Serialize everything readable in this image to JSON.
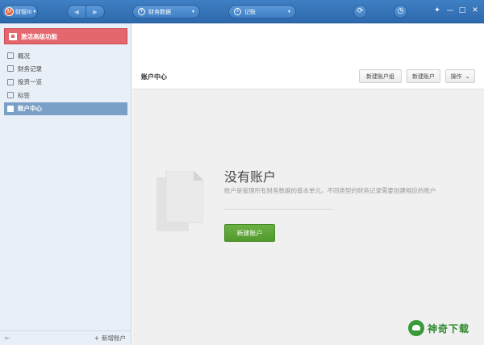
{
  "topbar": {
    "app_name": "财智III",
    "app_logo_glyph": "财",
    "nav_back": "◀",
    "nav_forward": "▶",
    "finance_dropdown": {
      "label": "财务数据",
      "icon": "¥"
    },
    "record_dropdown": {
      "label": "记账",
      "icon": "+"
    },
    "sync_icon": "⟳",
    "clock_icon": "◷",
    "window_controls": {
      "skin": "✦",
      "minimize": "—",
      "maximize": "□",
      "close": "✕"
    }
  },
  "sidebar": {
    "promo_label": "激活高级功能",
    "items": [
      {
        "label": "概况",
        "active": false
      },
      {
        "label": "财务记录",
        "active": false
      },
      {
        "label": "投资一览",
        "active": false
      },
      {
        "label": "标签",
        "active": false
      },
      {
        "label": "账户中心",
        "active": true
      }
    ],
    "footer": {
      "collapse_icon": "⇤",
      "add_label": "新增账户",
      "add_icon": "+"
    }
  },
  "main": {
    "title": "账户中心",
    "buttons": {
      "new_group": "新建账户组",
      "new_account": "新建账户",
      "actions": "操作",
      "actions_caret": "⌄"
    },
    "empty_state": {
      "title": "没有账户",
      "description": "账户是管理所有财务数据的基本单元，不同类型的财务记录需要创建相应的账户",
      "create_button": "新建账户"
    }
  },
  "watermark": {
    "text": "神奇下载"
  }
}
